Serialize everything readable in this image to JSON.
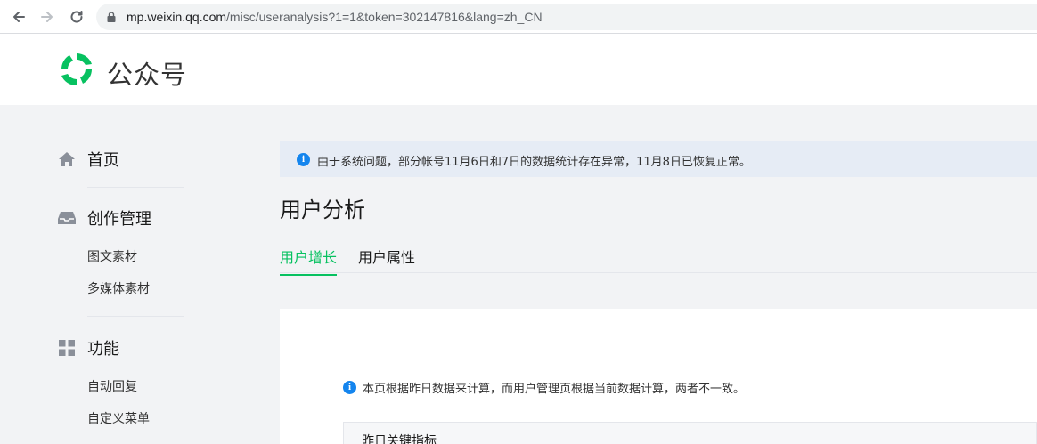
{
  "browser": {
    "url_host": "mp.weixin.qq.com",
    "url_path": "/misc/useranalysis?1=1&token=302147816&lang=zh_CN"
  },
  "header": {
    "logo_text": "公众号"
  },
  "sidebar": {
    "home": "首页",
    "content_mgmt": {
      "label": "创作管理",
      "items": [
        "图文素材",
        "多媒体素材"
      ]
    },
    "features": {
      "label": "功能",
      "items": [
        "自动回复",
        "自定义菜单"
      ]
    }
  },
  "notice": {
    "text": "由于系统问题，部分帐号11月6日和7日的数据统计存在异常，11月8日已恢复正常。"
  },
  "main": {
    "title": "用户分析",
    "tabs": [
      {
        "label": "用户增长",
        "active": true
      },
      {
        "label": "用户属性",
        "active": false
      }
    ],
    "tip": "本页根据昨日数据来计算，而用户管理页根据当前数据计算，两者不一致。",
    "metric_box_title": "昨日关键指标"
  },
  "colors": {
    "accent": "#07c160",
    "info": "#1485ee",
    "notice_bg": "#e6ecf5"
  }
}
